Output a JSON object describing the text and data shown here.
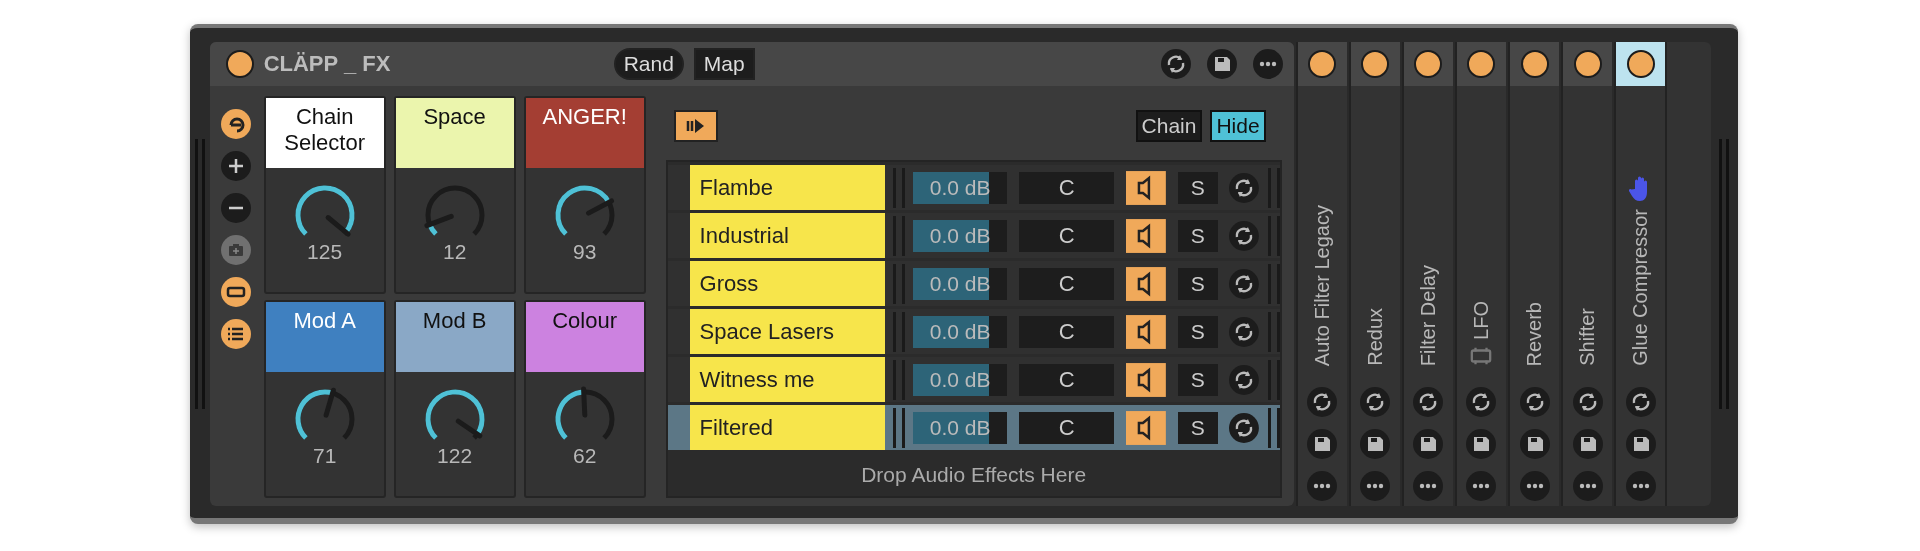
{
  "device": {
    "title": "CLÄPP _ FX",
    "on": true,
    "buttons": [
      {
        "label": "Rand",
        "kind": "pill"
      },
      {
        "label": "Map",
        "kind": "square"
      }
    ]
  },
  "macros": [
    {
      "label": "Chain Selector",
      "color": "#ffffff",
      "value": "125",
      "level": 0.98
    },
    {
      "label": "Space",
      "color": "#ebf5ad",
      "value": "12",
      "level": 0.09
    },
    {
      "label": "ANGER!",
      "color": "#a43e33",
      "value": "93",
      "level": 0.73
    },
    {
      "label": "Mod A",
      "color": "#3f80c0",
      "value": "71",
      "level": 0.56
    },
    {
      "label": "Mod B",
      "color": "#8aa8c6",
      "value": "122",
      "level": 0.96
    },
    {
      "label": "Colour",
      "color": "#cc82e0",
      "value": "62",
      "level": 0.49
    }
  ],
  "chain_toolbar": {
    "buttons": [
      {
        "label": "Chain",
        "selected": false
      },
      {
        "label": "Hide",
        "selected": true
      }
    ]
  },
  "chains": [
    {
      "name": "Flambe",
      "volume": "0.0 dB",
      "level": 0.8,
      "pan": "C",
      "active": true,
      "solo": "S",
      "selected": false
    },
    {
      "name": "Industrial",
      "volume": "0.0 dB",
      "level": 0.8,
      "pan": "C",
      "active": true,
      "solo": "S",
      "selected": false
    },
    {
      "name": "Gross",
      "volume": "0.0 dB",
      "level": 0.8,
      "pan": "C",
      "active": true,
      "solo": "S",
      "selected": false
    },
    {
      "name": "Space Lasers",
      "volume": "0.0 dB",
      "level": 0.8,
      "pan": "C",
      "active": true,
      "solo": "S",
      "selected": false
    },
    {
      "name": "Witness me",
      "volume": "0.0 dB",
      "level": 0.8,
      "pan": "C",
      "active": true,
      "solo": "S",
      "selected": false
    },
    {
      "name": "Filtered",
      "volume": "0.0 dB",
      "level": 0.8,
      "pan": "C",
      "active": true,
      "solo": "S",
      "selected": true
    }
  ],
  "drop_hint": "Drop Audio Effects Here",
  "devices": [
    {
      "name": "Auto Filter Legacy",
      "kind": "audio",
      "on": true,
      "selected": false
    },
    {
      "name": "Redux",
      "kind": "audio",
      "on": true,
      "selected": false
    },
    {
      "name": "Filter Delay",
      "kind": "audio",
      "on": true,
      "selected": false
    },
    {
      "name": "LFO",
      "kind": "max",
      "on": true,
      "selected": false
    },
    {
      "name": "Reverb",
      "kind": "audio",
      "on": true,
      "selected": false
    },
    {
      "name": "Shifter",
      "kind": "audio",
      "on": true,
      "selected": false
    },
    {
      "name": "Glue Compressor",
      "kind": "audio",
      "on": true,
      "selected": true
    }
  ]
}
